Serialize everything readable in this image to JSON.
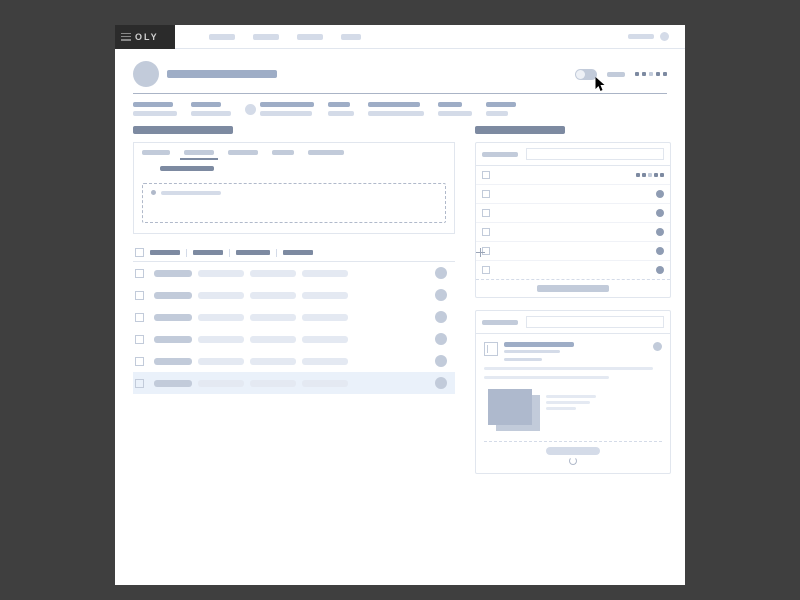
{
  "brand": {
    "logo_text": "OLY"
  },
  "topnav": {
    "items": [
      "",
      "",
      "",
      ""
    ],
    "user": ""
  },
  "header": {
    "title": "",
    "toggle_label": "",
    "status_dots": [
      "dk",
      "dk",
      "lt",
      "dk",
      "dk"
    ]
  },
  "meta_columns": [
    {
      "label": "",
      "value": ""
    },
    {
      "label": "",
      "value": ""
    },
    {
      "label": "",
      "value": ""
    },
    {
      "label": "",
      "value": ""
    },
    {
      "label": "",
      "value": ""
    },
    {
      "label": "",
      "value": ""
    },
    {
      "label": "",
      "value": ""
    }
  ],
  "left_section": {
    "heading": "",
    "tabs": [
      "",
      "",
      "",
      "",
      ""
    ],
    "active_tab_index": 1,
    "sub_heading": "",
    "drop_hint": "",
    "table": {
      "columns": [
        "",
        "",
        "",
        ""
      ],
      "rows": [
        {
          "cells": [
            "",
            "",
            "",
            ""
          ],
          "selected": false
        },
        {
          "cells": [
            "",
            "",
            "",
            ""
          ],
          "selected": false
        },
        {
          "cells": [
            "",
            "",
            "",
            ""
          ],
          "selected": false
        },
        {
          "cells": [
            "",
            "",
            "",
            ""
          ],
          "selected": false
        },
        {
          "cells": [
            "",
            "",
            "",
            ""
          ],
          "selected": false
        },
        {
          "cells": [
            "",
            "",
            "",
            ""
          ],
          "selected": true
        }
      ]
    }
  },
  "right_section": {
    "heading": "",
    "list_panel": {
      "filter_label": "",
      "items": [
        {
          "title": "",
          "subtitle": "",
          "status": [
            "dk",
            "dk",
            "lt",
            "dk",
            "dk"
          ]
        },
        {
          "title": "",
          "subtitle": "",
          "dot": true
        },
        {
          "title": "",
          "subtitle": "",
          "dot": true
        },
        {
          "title": "",
          "subtitle": "",
          "dot": true
        },
        {
          "title": "",
          "subtitle": "",
          "dot": true
        },
        {
          "title": "",
          "subtitle": "",
          "dot": true
        }
      ],
      "load_more": ""
    },
    "card_panel": {
      "title": "",
      "subtitle": "",
      "meta": "",
      "body_lines": [
        "",
        ""
      ],
      "thumb_lines": [
        "",
        "",
        ""
      ],
      "footer_action": ""
    }
  }
}
